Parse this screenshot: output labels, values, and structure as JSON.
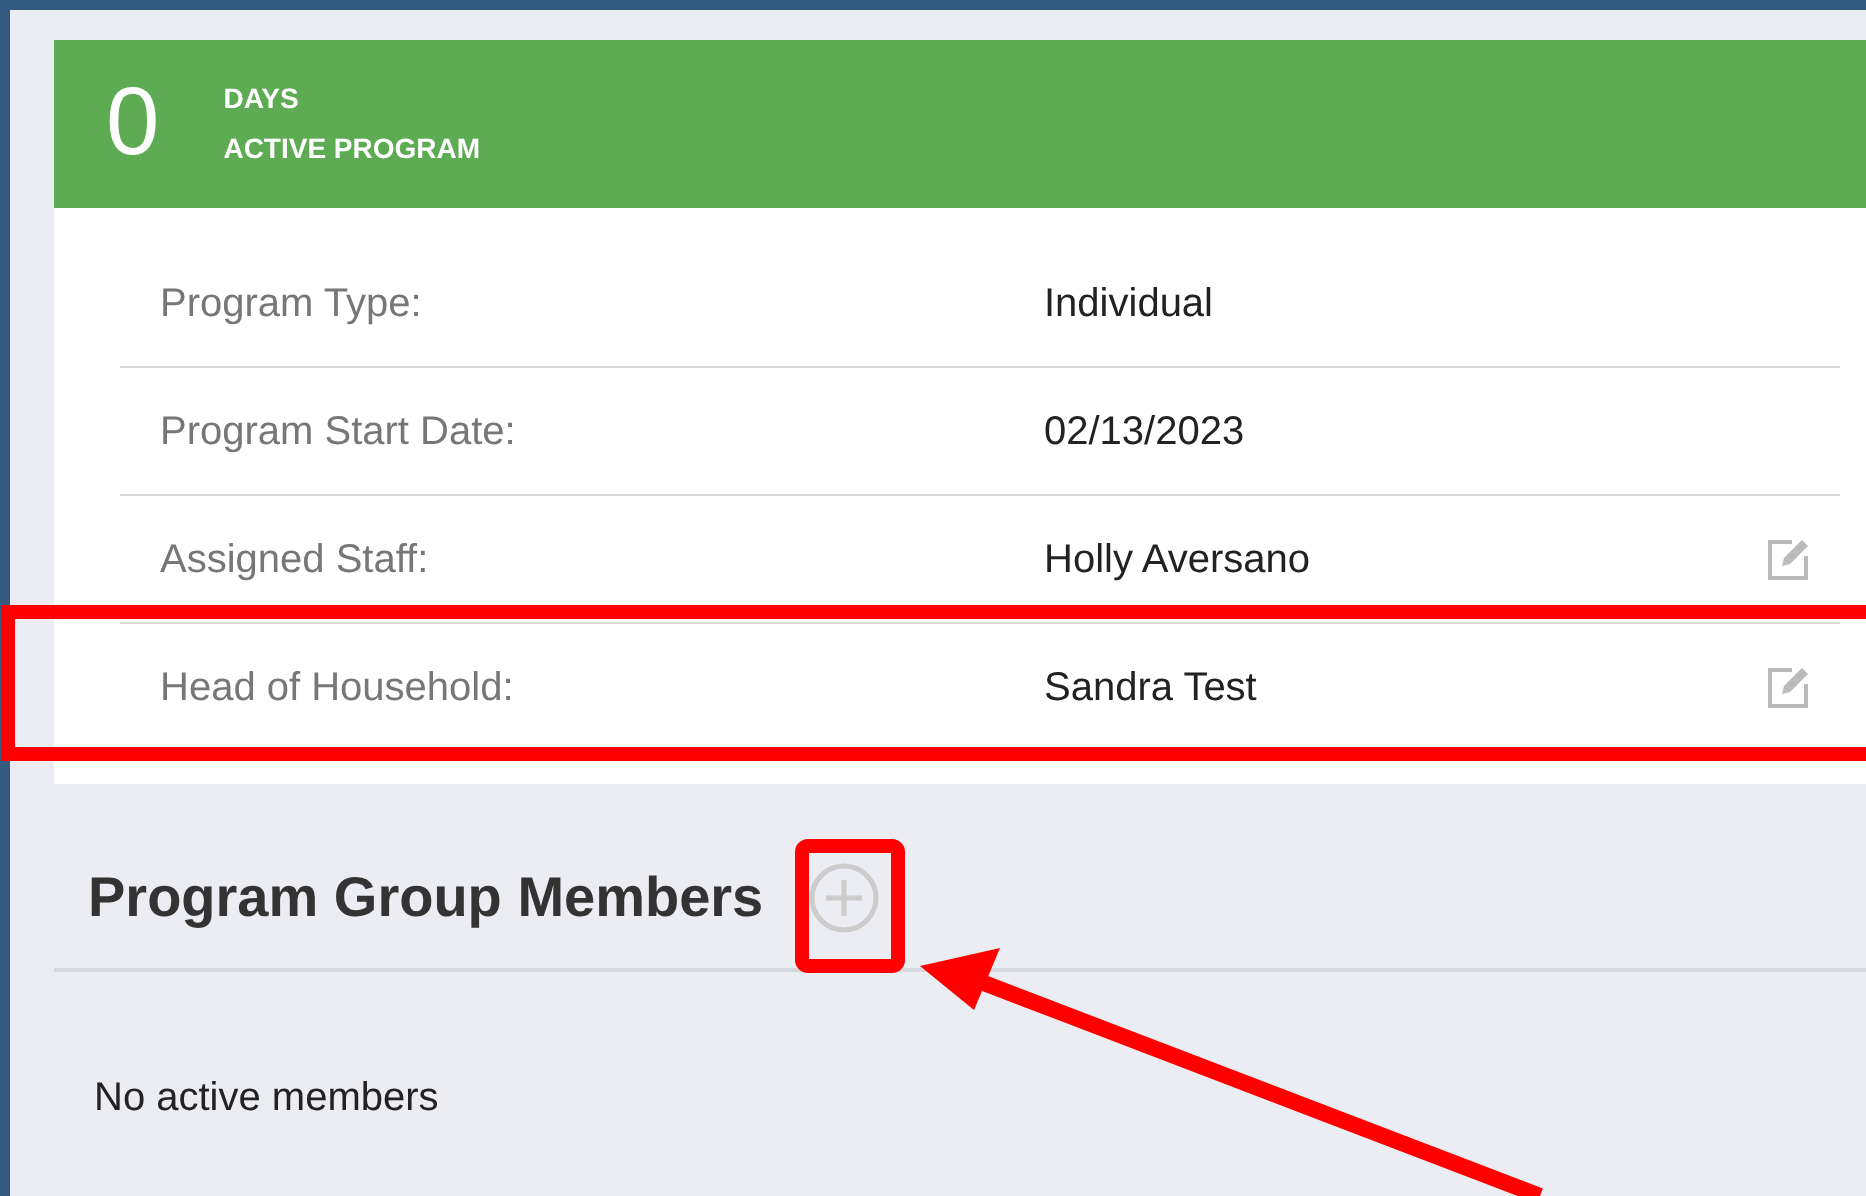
{
  "summary": {
    "count": "0",
    "unit": "DAYS",
    "caption": "ACTIVE PROGRAM"
  },
  "details": [
    {
      "label": "Program Type:",
      "value": "Individual",
      "editable": false
    },
    {
      "label": "Program Start Date:",
      "value": "02/13/2023",
      "editable": false
    },
    {
      "label": "Assigned Staff:",
      "value": "Holly Aversano",
      "editable": true
    },
    {
      "label": "Head of Household:",
      "value": "Sandra Test",
      "editable": true
    }
  ],
  "members": {
    "title": "Program Group Members",
    "empty_text": "No active members"
  }
}
